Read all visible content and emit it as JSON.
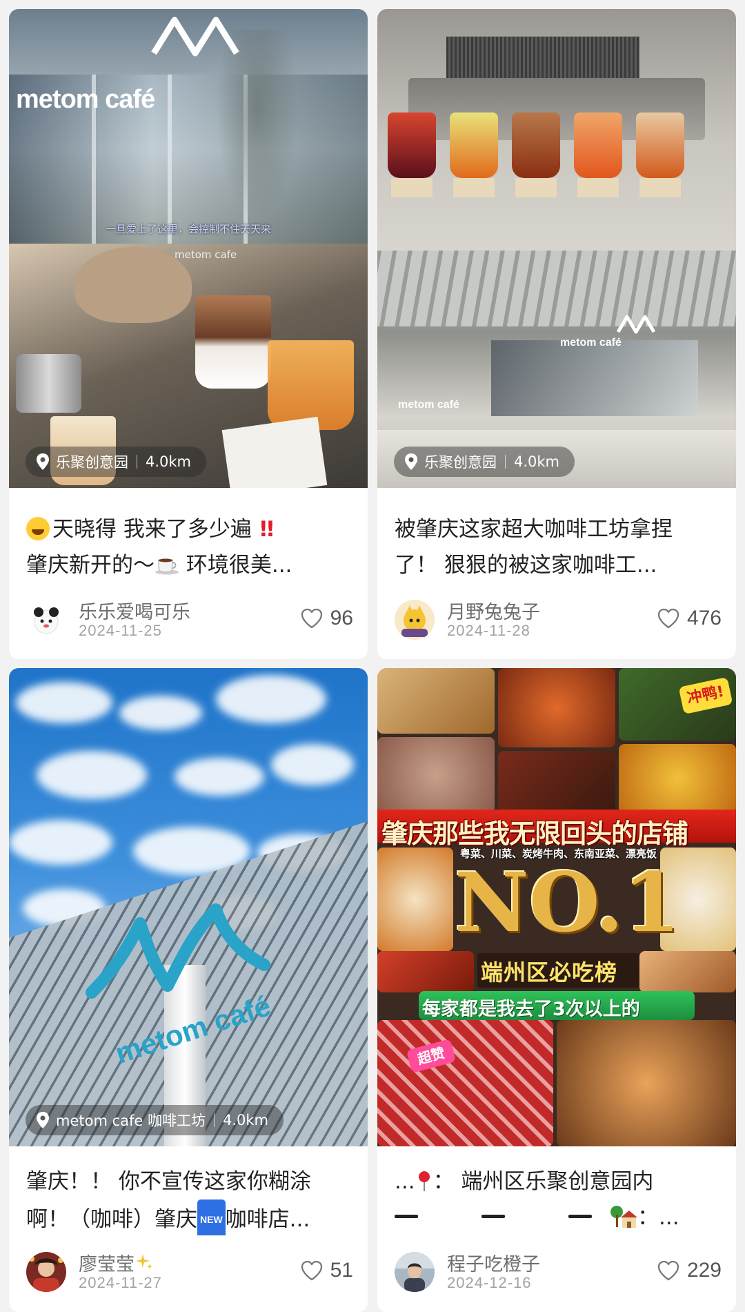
{
  "feed": {
    "cards": [
      {
        "location": "乐聚创意园",
        "distance": "4.0km",
        "cover_texts": {
          "sign": "metom café",
          "caption": "一旦爱上了这里，会控制不住天天来",
          "brand": "metom cafe"
        },
        "title_line1": "天晓得 我来了多少遍",
        "title_line2a": "肇庆新开的～",
        "title_line2b": " 环境很美...",
        "author": "乐乐爱喝可乐",
        "date": "2024-11-25",
        "likes": "96"
      },
      {
        "location": "乐聚创意园",
        "distance": "4.0km",
        "cover_texts": {
          "sign": "metom café",
          "sign2": "metom café"
        },
        "title_line1": "被肇庆这家超大咖啡工坊拿捏",
        "title_line2": "了！ 狠狠的被这家咖啡工...",
        "author": "月野兔兔子",
        "date": "2024-11-28",
        "likes": "476"
      },
      {
        "location": "metom cafe 咖啡工坊",
        "distance": "4.0km",
        "cover_texts": {
          "brand": "metom café"
        },
        "title_line1": "肇庆！！ 你不宣传这家你糊涂",
        "title_line2a": "啊！（咖啡）肇庆",
        "new_badge": "NEW",
        "title_line2b": "咖啡店...",
        "author": "廖莹莹",
        "date": "2024-11-27",
        "likes": "51"
      },
      {
        "cover_texts": {
          "banner": "肇庆那些我无限回头的店铺",
          "sub": "粤菜、川菜、炭烤牛肉、东南亚菜、漂亮饭",
          "no1": "NO.1",
          "district": "端州区必吃榜",
          "ribbon": "每家都是我去了3次以上的",
          "sticker": "冲鸭!",
          "sticker2": "超赞"
        },
        "title_line1a": "...",
        "title_line1b": "： 端州区乐聚创意园内",
        "title_line2": "：...",
        "author": "程子吃橙子",
        "date": "2024-12-16",
        "likes": "229"
      }
    ]
  },
  "colors": {
    "background": "#f2f2f2",
    "card": "#ffffff",
    "title_text": "#222222",
    "author_text": "#6e6e6e",
    "date_text": "#a3a3a3",
    "exclaim_red": "#e11d2b"
  },
  "icons": [
    "location-pin-icon",
    "heart-icon",
    "laugh-emoji-icon",
    "double-exclamation-icon",
    "coffee-emoji-icon",
    "new-badge-icon",
    "pin-emoji-icon",
    "house-emoji-icon"
  ]
}
